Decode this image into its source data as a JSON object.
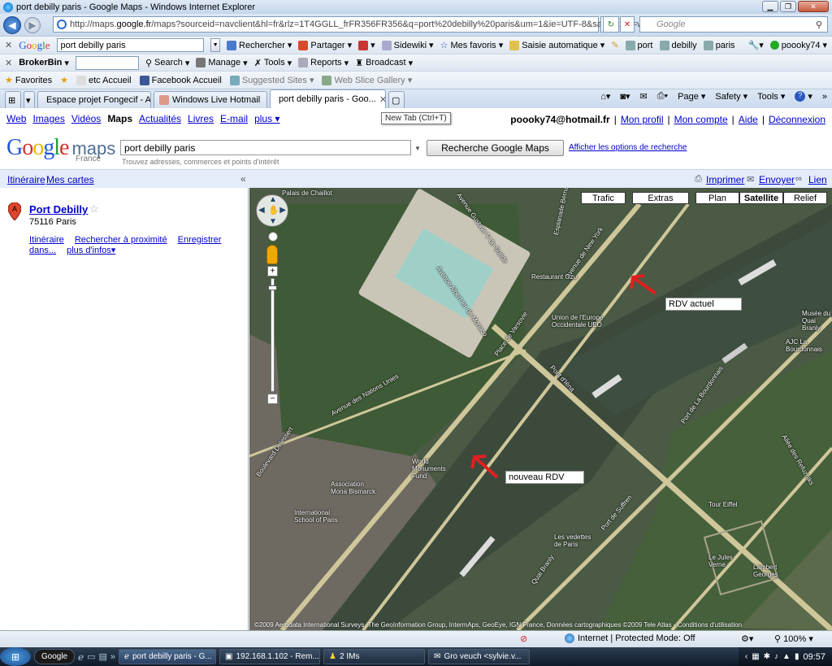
{
  "window": {
    "title": "port debilly paris - Google Maps - Windows Internet Explorer"
  },
  "address_bar": {
    "url_prefix": "http://maps.",
    "url_host": "google.fr",
    "url_rest": "/maps?sourceid=navclient&hl=fr&rlz=1T4GGLL_frFR356FR356&q=port%20debilly%20paris&um=1&ie=UTF-8&sa=N&tab=wl",
    "search_placeholder": "Google"
  },
  "google_toolbar": {
    "query": "port debilly paris",
    "items": [
      "Rechercher",
      "Partager",
      "Sidewiki",
      "Mes favoris",
      "Saisie automatique",
      "port",
      "debilly",
      "paris",
      "poooky74"
    ]
  },
  "broker_toolbar": {
    "items": [
      "BrokerBin",
      "Search",
      "Manage",
      "Tools",
      "Reports",
      "Broadcast"
    ]
  },
  "favorites_bar": {
    "items": [
      "Favorites",
      "etc Accueil",
      "Facebook Accueil",
      "Suggested Sites",
      "Web Slice Gallery"
    ]
  },
  "tabs": [
    {
      "label": "Espace projet Fongecif - A..."
    },
    {
      "label": "Windows Live Hotmail"
    },
    {
      "label": "port debilly paris - Goo..."
    }
  ],
  "ie_commands": [
    "Page",
    "Safety",
    "Tools"
  ],
  "tooltip": "New Tab (Ctrl+T)",
  "google_nav": {
    "links": [
      "Web",
      "Images",
      "Vidéos",
      "Maps",
      "Actualités",
      "Livres",
      "E-mail",
      "plus ▾"
    ],
    "account_email": "poooky74@hotmail.fr",
    "account_links": [
      "Mon profil",
      "Mon compte",
      "Aide",
      "Déconnexion"
    ]
  },
  "maps_header": {
    "logo_sub": "France",
    "query": "port debilly paris",
    "hint": "Trouvez adresses, commerces et points d'intérêt",
    "search_button": "Recherche Google Maps",
    "options_link": "Afficher les options de recherche"
  },
  "map_links": {
    "itinerary": "Itinéraire",
    "my_maps": "Mes cartes",
    "print": "Imprimer",
    "send": "Envoyer",
    "link": "Lien"
  },
  "result": {
    "marker": "A",
    "title": "Port Debilly",
    "address": "75116 Paris",
    "links": [
      "Itinéraire",
      "Rechercher à proximité",
      "Enregistrer dans...",
      "plus d'infos▾"
    ]
  },
  "map": {
    "buttons": [
      "Trafic",
      "Extras",
      "Plan",
      "Satellite",
      "Relief"
    ],
    "selected_button": "Satellite",
    "annotations": [
      "RDV actuel",
      "nouveau RDV"
    ],
    "labels": [
      "Palais de Chaillot",
      "Avenue Gustave V de Suède",
      "Esplanade Bernard",
      "Avenue de New York",
      "Restaurant Ozu",
      "Union de l'Europe Occidentale UEO",
      "Avenue Albert Ier de Monaco",
      "Place de Varsovie",
      "Pont d'Iéna",
      "Avenue des Nations Unies",
      "Boulevard Delessert",
      "World Monuments Fund",
      "Association Mona Bismarck",
      "International School of Paris",
      "Quai Branly",
      "Port de La Bourdonnais",
      "Tour Eiffel",
      "Port de Suffren",
      "Les vedettes de Paris",
      "Le Jules Verne",
      "Lambert Georges",
      "Musée du Quai Branly",
      "AJC La Bourdonnais",
      "Allée des Refuzniks"
    ],
    "copyright": "©2009 Aerodata International Surveys, The GeoInformation Group, IntermAps, GeoEye, IGN France, Données cartographiques ©2009 Tele Atlas - Conditions d'utilisation"
  },
  "status_bar": {
    "zone": "Internet | Protected Mode: Off",
    "zoom": "100%"
  },
  "taskbar": {
    "search": "Google",
    "tasks": [
      "port debilly paris - G...",
      "192.168.1.102 - Rem...",
      "2 IMs",
      "Gro veuch <sylvie.v..."
    ],
    "clock": "09:57"
  }
}
